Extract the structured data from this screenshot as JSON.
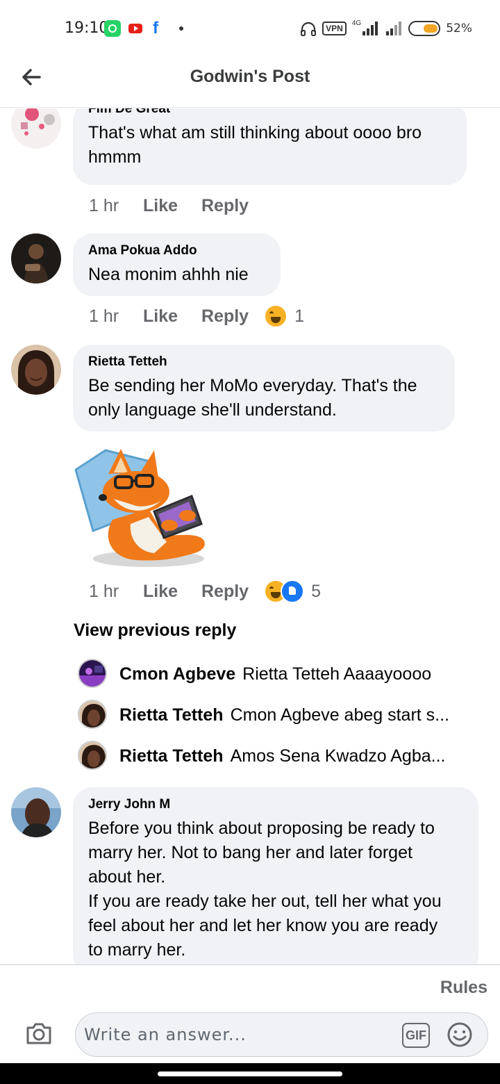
{
  "status_bar": {
    "time": "19:10",
    "vpn": "VPN",
    "network": "4G",
    "battery": "52%",
    "battery_level": 0.52
  },
  "header": {
    "title": "Godwin's Post"
  },
  "comments": [
    {
      "author": "Fiifi De Great",
      "text": "That's what am still thinking about oooo bro hmmm",
      "time": "1 hr",
      "like": "Like",
      "reply": "Reply"
    },
    {
      "author": "Ama Pokua Addo",
      "text": "Nea monim ahhh nie",
      "time": "1 hr",
      "like": "Like",
      "reply": "Reply",
      "reactions": [
        "haha"
      ],
      "reaction_count": "1"
    },
    {
      "author": "Rietta Tetteh",
      "text": "Be sending her MoMo everyday. That's the only language she'll understand.",
      "time": "1 hr",
      "like": "Like",
      "reply": "Reply",
      "reactions": [
        "haha",
        "like"
      ],
      "reaction_count": "5",
      "sticker": "fox-with-glasses-tablet-sticker"
    },
    {
      "author": "Jerry John M",
      "text_lines": [
        "Before you think about proposing be ready to",
        "marry her. Not to bang her and later forget",
        "about her.",
        "If you are ready take her out, tell her what you",
        "feel about her and let her know you are ready",
        "to marry her."
      ]
    }
  ],
  "view_previous_reply": "View previous reply",
  "replies": [
    {
      "author": "Cmon Agbeve",
      "text": "Rietta Tetteh Aaaayoooo"
    },
    {
      "author": "Rietta Tetteh",
      "text": "Cmon Agbeve abeg start s..."
    },
    {
      "author": "Rietta Tetteh",
      "text": "Amos Sena Kwadzo Agba..."
    }
  ],
  "footer": {
    "rules": "Rules",
    "placeholder": "Write an answer...",
    "gif": "GIF"
  },
  "colors": {
    "bubble": "#f0f2f5",
    "meta_text": "#65676b",
    "like_blue": "#1877f2",
    "haha_yellow": "#f7b125"
  }
}
